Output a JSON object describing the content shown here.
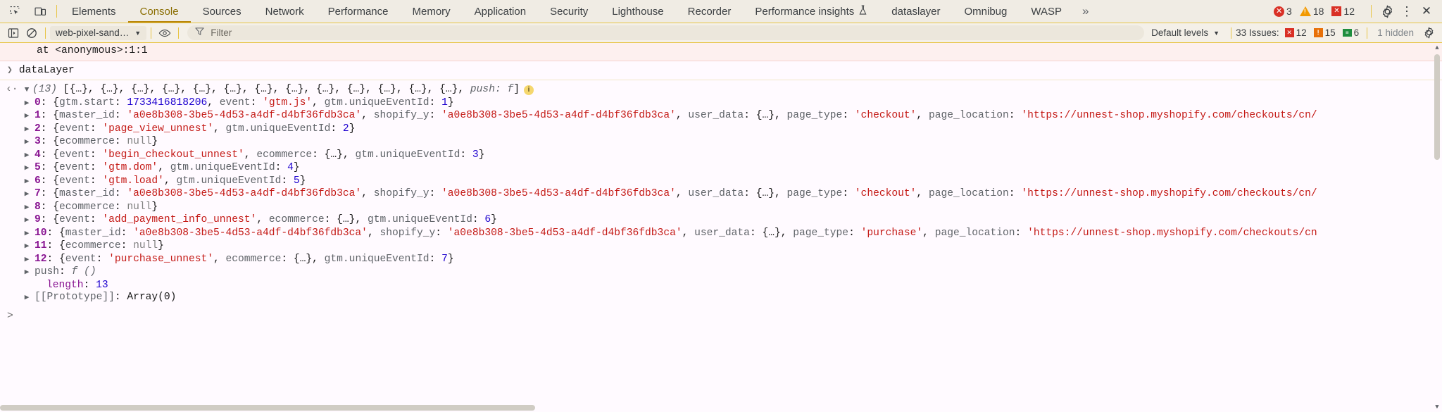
{
  "tabbar": {
    "left_icons": [
      {
        "name": "inspect-element-icon",
        "label": "inspect"
      },
      {
        "name": "device-toolbar-icon",
        "label": "device"
      }
    ],
    "tabs": [
      {
        "label": "Elements",
        "active": false
      },
      {
        "label": "Console",
        "active": true
      },
      {
        "label": "Sources",
        "active": false
      },
      {
        "label": "Network",
        "active": false
      },
      {
        "label": "Performance",
        "active": false
      },
      {
        "label": "Memory",
        "active": false
      },
      {
        "label": "Application",
        "active": false
      },
      {
        "label": "Security",
        "active": false
      },
      {
        "label": "Lighthouse",
        "active": false
      },
      {
        "label": "Recorder",
        "active": false
      },
      {
        "label": "Performance insights",
        "active": false,
        "suffix_icon": "flask-icon"
      },
      {
        "label": "dataslayer",
        "active": false
      },
      {
        "label": "Omnibug",
        "active": false
      },
      {
        "label": "WASP",
        "active": false
      }
    ],
    "more_tabs_label": "»",
    "counters": {
      "errors": "3",
      "warnings": "18",
      "verbose": "12"
    },
    "settings_label": "⚙",
    "more_label": "⋮",
    "close_label": "✕"
  },
  "toolbar": {
    "sidebar_icon": "console-sidebar-icon",
    "clear_icon": "clear-console-icon",
    "context_value": "web-pixel-sand…",
    "eye_icon": "live-expression-icon",
    "filter_icon": "filter-icon",
    "filter_placeholder": "Filter",
    "levels_value": "Default levels",
    "issues_label": "33 Issues:",
    "issues_errors": "12",
    "issues_warnings": "15",
    "issues_info": "6",
    "hidden_label": "1 hidden",
    "settings_icon": "console-settings-icon"
  },
  "console": {
    "error_stack_line": "at <anonymous>:1:1",
    "input_expression": "dataLayer",
    "result_header": {
      "count": "(13)",
      "preview_items": [
        "{…}",
        "{…}",
        "{…}",
        "{…}",
        "{…}",
        "{…}",
        "{…}",
        "{…}",
        "{…}",
        "{…}",
        "{…}",
        "{…}",
        "{…}"
      ],
      "push_key": "push:",
      "push_value": "f",
      "info_badge": "i"
    },
    "rows": [
      {
        "index": "0",
        "segments": [
          {
            "t": "{",
            "c": "punct"
          },
          {
            "t": "gtm.start",
            "c": "key"
          },
          {
            "t": ": ",
            "c": "punct"
          },
          {
            "t": "1733416818206",
            "c": "num"
          },
          {
            "t": ", ",
            "c": "punct"
          },
          {
            "t": "event",
            "c": "key"
          },
          {
            "t": ": ",
            "c": "punct"
          },
          {
            "t": "'gtm.js'",
            "c": "str"
          },
          {
            "t": ", ",
            "c": "punct"
          },
          {
            "t": "gtm.uniqueEventId",
            "c": "key"
          },
          {
            "t": ": ",
            "c": "punct"
          },
          {
            "t": "1",
            "c": "num"
          },
          {
            "t": "}",
            "c": "punct"
          }
        ]
      },
      {
        "index": "1",
        "segments": [
          {
            "t": "{",
            "c": "punct"
          },
          {
            "t": "master_id",
            "c": "key"
          },
          {
            "t": ": ",
            "c": "punct"
          },
          {
            "t": "'a0e8b308-3be5-4d53-a4df-d4bf36fdb3ca'",
            "c": "str"
          },
          {
            "t": ", ",
            "c": "punct"
          },
          {
            "t": "shopify_y",
            "c": "key"
          },
          {
            "t": ": ",
            "c": "punct"
          },
          {
            "t": "'a0e8b308-3be5-4d53-a4df-d4bf36fdb3ca'",
            "c": "str"
          },
          {
            "t": ", ",
            "c": "punct"
          },
          {
            "t": "user_data",
            "c": "key"
          },
          {
            "t": ": ",
            "c": "punct"
          },
          {
            "t": "{…}",
            "c": "punct"
          },
          {
            "t": ", ",
            "c": "punct"
          },
          {
            "t": "page_type",
            "c": "key"
          },
          {
            "t": ": ",
            "c": "punct"
          },
          {
            "t": "'checkout'",
            "c": "str"
          },
          {
            "t": ", ",
            "c": "punct"
          },
          {
            "t": "page_location",
            "c": "key"
          },
          {
            "t": ": ",
            "c": "punct"
          },
          {
            "t": "'https://unnest-shop.myshopify.com/checkouts/cn/",
            "c": "str"
          }
        ]
      },
      {
        "index": "2",
        "segments": [
          {
            "t": "{",
            "c": "punct"
          },
          {
            "t": "event",
            "c": "key"
          },
          {
            "t": ": ",
            "c": "punct"
          },
          {
            "t": "'page_view_unnest'",
            "c": "str"
          },
          {
            "t": ", ",
            "c": "punct"
          },
          {
            "t": "gtm.uniqueEventId",
            "c": "key"
          },
          {
            "t": ": ",
            "c": "punct"
          },
          {
            "t": "2",
            "c": "num"
          },
          {
            "t": "}",
            "c": "punct"
          }
        ]
      },
      {
        "index": "3",
        "segments": [
          {
            "t": "{",
            "c": "punct"
          },
          {
            "t": "ecommerce",
            "c": "key"
          },
          {
            "t": ": ",
            "c": "punct"
          },
          {
            "t": "null",
            "c": "nul"
          },
          {
            "t": "}",
            "c": "punct"
          }
        ]
      },
      {
        "index": "4",
        "segments": [
          {
            "t": "{",
            "c": "punct"
          },
          {
            "t": "event",
            "c": "key"
          },
          {
            "t": ": ",
            "c": "punct"
          },
          {
            "t": "'begin_checkout_unnest'",
            "c": "str"
          },
          {
            "t": ", ",
            "c": "punct"
          },
          {
            "t": "ecommerce",
            "c": "key"
          },
          {
            "t": ": ",
            "c": "punct"
          },
          {
            "t": "{…}",
            "c": "punct"
          },
          {
            "t": ", ",
            "c": "punct"
          },
          {
            "t": "gtm.uniqueEventId",
            "c": "key"
          },
          {
            "t": ": ",
            "c": "punct"
          },
          {
            "t": "3",
            "c": "num"
          },
          {
            "t": "}",
            "c": "punct"
          }
        ]
      },
      {
        "index": "5",
        "segments": [
          {
            "t": "{",
            "c": "punct"
          },
          {
            "t": "event",
            "c": "key"
          },
          {
            "t": ": ",
            "c": "punct"
          },
          {
            "t": "'gtm.dom'",
            "c": "str"
          },
          {
            "t": ", ",
            "c": "punct"
          },
          {
            "t": "gtm.uniqueEventId",
            "c": "key"
          },
          {
            "t": ": ",
            "c": "punct"
          },
          {
            "t": "4",
            "c": "num"
          },
          {
            "t": "}",
            "c": "punct"
          }
        ]
      },
      {
        "index": "6",
        "segments": [
          {
            "t": "{",
            "c": "punct"
          },
          {
            "t": "event",
            "c": "key"
          },
          {
            "t": ": ",
            "c": "punct"
          },
          {
            "t": "'gtm.load'",
            "c": "str"
          },
          {
            "t": ", ",
            "c": "punct"
          },
          {
            "t": "gtm.uniqueEventId",
            "c": "key"
          },
          {
            "t": ": ",
            "c": "punct"
          },
          {
            "t": "5",
            "c": "num"
          },
          {
            "t": "}",
            "c": "punct"
          }
        ]
      },
      {
        "index": "7",
        "segments": [
          {
            "t": "{",
            "c": "punct"
          },
          {
            "t": "master_id",
            "c": "key"
          },
          {
            "t": ": ",
            "c": "punct"
          },
          {
            "t": "'a0e8b308-3be5-4d53-a4df-d4bf36fdb3ca'",
            "c": "str"
          },
          {
            "t": ", ",
            "c": "punct"
          },
          {
            "t": "shopify_y",
            "c": "key"
          },
          {
            "t": ": ",
            "c": "punct"
          },
          {
            "t": "'a0e8b308-3be5-4d53-a4df-d4bf36fdb3ca'",
            "c": "str"
          },
          {
            "t": ", ",
            "c": "punct"
          },
          {
            "t": "user_data",
            "c": "key"
          },
          {
            "t": ": ",
            "c": "punct"
          },
          {
            "t": "{…}",
            "c": "punct"
          },
          {
            "t": ", ",
            "c": "punct"
          },
          {
            "t": "page_type",
            "c": "key"
          },
          {
            "t": ": ",
            "c": "punct"
          },
          {
            "t": "'checkout'",
            "c": "str"
          },
          {
            "t": ", ",
            "c": "punct"
          },
          {
            "t": "page_location",
            "c": "key"
          },
          {
            "t": ": ",
            "c": "punct"
          },
          {
            "t": "'https://unnest-shop.myshopify.com/checkouts/cn/",
            "c": "str"
          }
        ]
      },
      {
        "index": "8",
        "segments": [
          {
            "t": "{",
            "c": "punct"
          },
          {
            "t": "ecommerce",
            "c": "key"
          },
          {
            "t": ": ",
            "c": "punct"
          },
          {
            "t": "null",
            "c": "nul"
          },
          {
            "t": "}",
            "c": "punct"
          }
        ]
      },
      {
        "index": "9",
        "segments": [
          {
            "t": "{",
            "c": "punct"
          },
          {
            "t": "event",
            "c": "key"
          },
          {
            "t": ": ",
            "c": "punct"
          },
          {
            "t": "'add_payment_info_unnest'",
            "c": "str"
          },
          {
            "t": ", ",
            "c": "punct"
          },
          {
            "t": "ecommerce",
            "c": "key"
          },
          {
            "t": ": ",
            "c": "punct"
          },
          {
            "t": "{…}",
            "c": "punct"
          },
          {
            "t": ", ",
            "c": "punct"
          },
          {
            "t": "gtm.uniqueEventId",
            "c": "key"
          },
          {
            "t": ": ",
            "c": "punct"
          },
          {
            "t": "6",
            "c": "num"
          },
          {
            "t": "}",
            "c": "punct"
          }
        ]
      },
      {
        "index": "10",
        "segments": [
          {
            "t": "{",
            "c": "punct"
          },
          {
            "t": "master_id",
            "c": "key"
          },
          {
            "t": ": ",
            "c": "punct"
          },
          {
            "t": "'a0e8b308-3be5-4d53-a4df-d4bf36fdb3ca'",
            "c": "str"
          },
          {
            "t": ", ",
            "c": "punct"
          },
          {
            "t": "shopify_y",
            "c": "key"
          },
          {
            "t": ": ",
            "c": "punct"
          },
          {
            "t": "'a0e8b308-3be5-4d53-a4df-d4bf36fdb3ca'",
            "c": "str"
          },
          {
            "t": ", ",
            "c": "punct"
          },
          {
            "t": "user_data",
            "c": "key"
          },
          {
            "t": ": ",
            "c": "punct"
          },
          {
            "t": "{…}",
            "c": "punct"
          },
          {
            "t": ", ",
            "c": "punct"
          },
          {
            "t": "page_type",
            "c": "key"
          },
          {
            "t": ": ",
            "c": "punct"
          },
          {
            "t": "'purchase'",
            "c": "str"
          },
          {
            "t": ", ",
            "c": "punct"
          },
          {
            "t": "page_location",
            "c": "key"
          },
          {
            "t": ": ",
            "c": "punct"
          },
          {
            "t": "'https://unnest-shop.myshopify.com/checkouts/cn",
            "c": "str"
          }
        ]
      },
      {
        "index": "11",
        "segments": [
          {
            "t": "{",
            "c": "punct"
          },
          {
            "t": "ecommerce",
            "c": "key"
          },
          {
            "t": ": ",
            "c": "punct"
          },
          {
            "t": "null",
            "c": "nul"
          },
          {
            "t": "}",
            "c": "punct"
          }
        ]
      },
      {
        "index": "12",
        "segments": [
          {
            "t": "{",
            "c": "punct"
          },
          {
            "t": "event",
            "c": "key"
          },
          {
            "t": ": ",
            "c": "punct"
          },
          {
            "t": "'purchase_unnest'",
            "c": "str"
          },
          {
            "t": ", ",
            "c": "punct"
          },
          {
            "t": "ecommerce",
            "c": "key"
          },
          {
            "t": ": ",
            "c": "punct"
          },
          {
            "t": "{…}",
            "c": "punct"
          },
          {
            "t": ", ",
            "c": "punct"
          },
          {
            "t": "gtm.uniqueEventId",
            "c": "key"
          },
          {
            "t": ": ",
            "c": "punct"
          },
          {
            "t": "7",
            "c": "num"
          },
          {
            "t": "}",
            "c": "punct"
          }
        ]
      }
    ],
    "push_row": {
      "key": "push",
      "value": "f ()"
    },
    "length_row": {
      "key": "length",
      "value": "13"
    },
    "prototype_row": {
      "key": "[[Prototype]]",
      "value": "Array(0)"
    },
    "prompt": ">"
  }
}
